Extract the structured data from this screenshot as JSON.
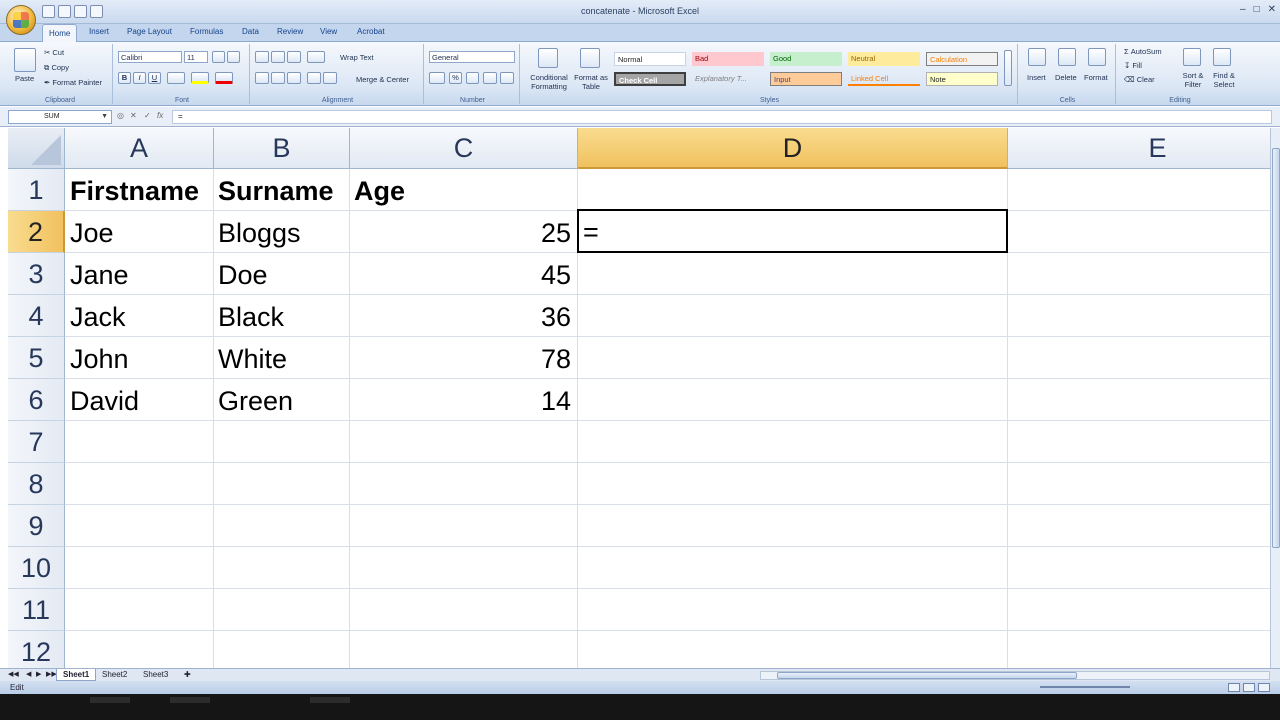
{
  "window": {
    "title": "concatenate - Microsoft Excel"
  },
  "tabs": [
    "Home",
    "Insert",
    "Page Layout",
    "Formulas",
    "Data",
    "Review",
    "View",
    "Acrobat"
  ],
  "ribbon": {
    "clipboard": {
      "paste": "Paste",
      "cut": "Cut",
      "copy": "Copy",
      "format_painter": "Format Painter",
      "label": "Clipboard"
    },
    "font": {
      "name": "Calibri",
      "size": "11",
      "label": "Font"
    },
    "alignment": {
      "wrap": "Wrap Text",
      "merge": "Merge & Center",
      "label": "Alignment"
    },
    "number": {
      "format": "General",
      "label": "Number"
    },
    "styles": {
      "conditional": "Conditional Formatting",
      "format_table": "Format as Table",
      "cells": [
        "Normal",
        "Bad",
        "Good",
        "Neutral",
        "Calculation",
        "Check Cell",
        "Explanatory T...",
        "Input",
        "Linked Cell",
        "Note"
      ],
      "label": "Styles"
    },
    "cells": {
      "insert": "Insert",
      "delete": "Delete",
      "format": "Format",
      "label": "Cells"
    },
    "editing": {
      "autosum": "AutoSum",
      "fill": "Fill",
      "clear": "Clear",
      "sort": "Sort & Filter",
      "find": "Find & Select",
      "label": "Editing"
    }
  },
  "formula_bar": {
    "name_box": "SUM",
    "formula": "="
  },
  "columns": [
    "A",
    "B",
    "C",
    "D",
    "E"
  ],
  "rows": [
    "1",
    "2",
    "3",
    "4",
    "5",
    "6",
    "7",
    "8",
    "9",
    "10",
    "11",
    "12"
  ],
  "sheet": {
    "header": [
      "Firstname",
      "Surname",
      "Age"
    ],
    "data": [
      [
        "Joe",
        "Bloggs",
        "25"
      ],
      [
        "Jane",
        "Doe",
        "45"
      ],
      [
        "Jack",
        "Black",
        "36"
      ],
      [
        "John",
        "White",
        "78"
      ],
      [
        "David",
        "Green",
        "14"
      ]
    ],
    "active_cell_content": "="
  },
  "sheet_tabs": [
    "Sheet1",
    "Sheet2",
    "Sheet3"
  ],
  "status": {
    "mode": "Edit"
  }
}
